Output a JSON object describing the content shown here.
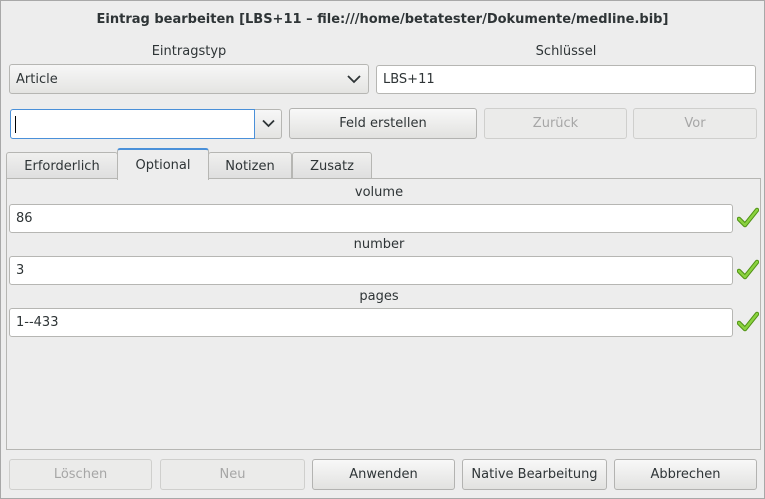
{
  "window": {
    "title": "Eintrag bearbeiten [LBS+11 – file:///home/betatester/Dokumente/medline.bib]"
  },
  "entry_type": {
    "label": "Eintragstyp",
    "selected": "Article"
  },
  "key": {
    "label": "Schlüssel",
    "value": "LBS+11"
  },
  "field_combo": {
    "value": ""
  },
  "toolbar": {
    "create_field": "Feld erstellen",
    "back": "Zurück",
    "forward": "Vor"
  },
  "tabs": [
    {
      "label": "Erforderlich"
    },
    {
      "label": "Optional"
    },
    {
      "label": "Notizen"
    },
    {
      "label": "Zusatz"
    }
  ],
  "fields": [
    {
      "label": "volume",
      "value": "86"
    },
    {
      "label": "number",
      "value": "3"
    },
    {
      "label": "pages",
      "value": "1--433"
    }
  ],
  "buttons": {
    "delete": "Löschen",
    "new": "Neu",
    "apply": "Anwenden",
    "native_edit": "Native Bearbeitung",
    "cancel": "Abbrechen"
  },
  "colors": {
    "accent": "#4a90d9",
    "check": "#73c226"
  }
}
